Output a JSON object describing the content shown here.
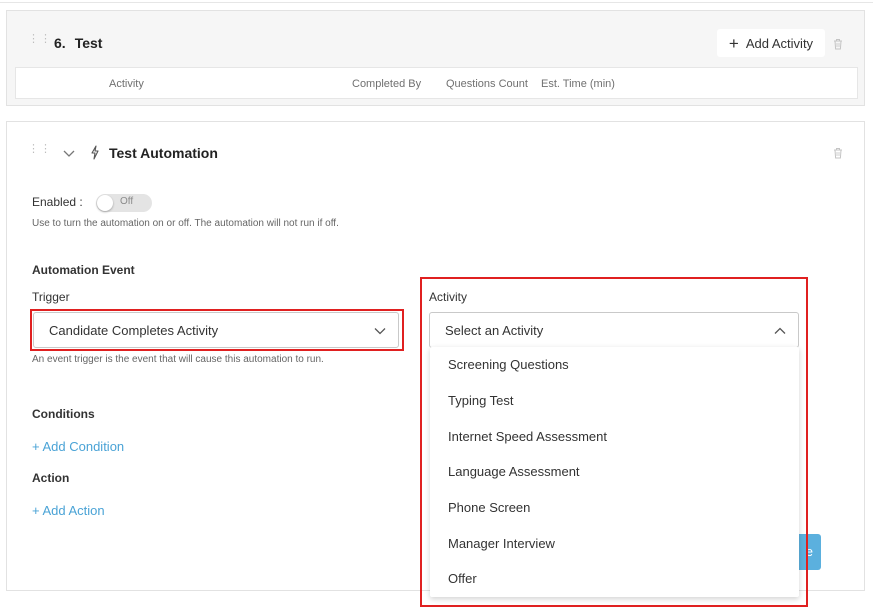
{
  "stage": {
    "number": "6.",
    "title": "Test",
    "add_activity_label": "Add Activity",
    "columns": [
      "Activity",
      "Completed By",
      "Questions Count",
      "Est. Time (min)"
    ]
  },
  "automation": {
    "title": "Test Automation",
    "enabled_label": "Enabled :",
    "toggle_state": "Off",
    "enabled_hint": "Use to turn the automation on or off. The automation will not run if off.",
    "event_section": "Automation Event",
    "trigger_label": "Trigger",
    "trigger_value": "Candidate Completes Activity",
    "trigger_hint": "An event trigger is the event that will cause this automation to run.",
    "activity_label": "Activity",
    "activity_placeholder": "Select an Activity",
    "conditions_title": "Conditions",
    "add_condition_label": "+ Add Condition",
    "action_title": "Action",
    "add_action_label": "+ Add Action",
    "save_label_partial": "e"
  },
  "activity_options": [
    "Screening Questions",
    "Typing Test",
    "Internet Speed Assessment",
    "Language Assessment",
    "Phone Screen",
    "Manager Interview",
    "Offer"
  ],
  "colors": {
    "link": "#4aa3d6",
    "highlight": "#e02020",
    "button": "#5bb0de"
  },
  "icons": [
    "drag-handle-icon",
    "plus-icon",
    "trash-icon",
    "chevron-down-icon",
    "lightning-bolt-icon",
    "chevron-up-icon"
  ]
}
